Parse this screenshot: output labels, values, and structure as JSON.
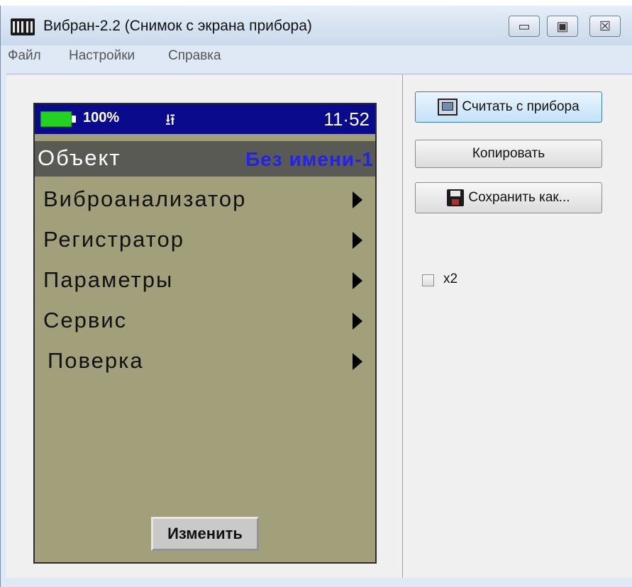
{
  "window": {
    "title": "Вибран-2.2 (Снимок с экрана прибора)"
  },
  "title_buttons": {
    "minimize": "▭",
    "maximize": "▣",
    "close": "☒"
  },
  "menu": {
    "items": [
      "Файл",
      "Настройки",
      "Справка"
    ]
  },
  "device": {
    "battery_text": "100%",
    "usb_icon": "⭿",
    "clock": "11·52",
    "object_label": "Объект",
    "object_value": "Без имени-1",
    "items": [
      "Виброанализатор",
      "Регистратор",
      "Параметры",
      "Сервис",
      "Поверка"
    ],
    "button_label": "Изменить"
  },
  "panel": {
    "read_button": "Считать с прибора",
    "copy_button": "Копировать",
    "save_button": "Сохранить как...",
    "x2_label": "x2",
    "x2_checked": false
  }
}
